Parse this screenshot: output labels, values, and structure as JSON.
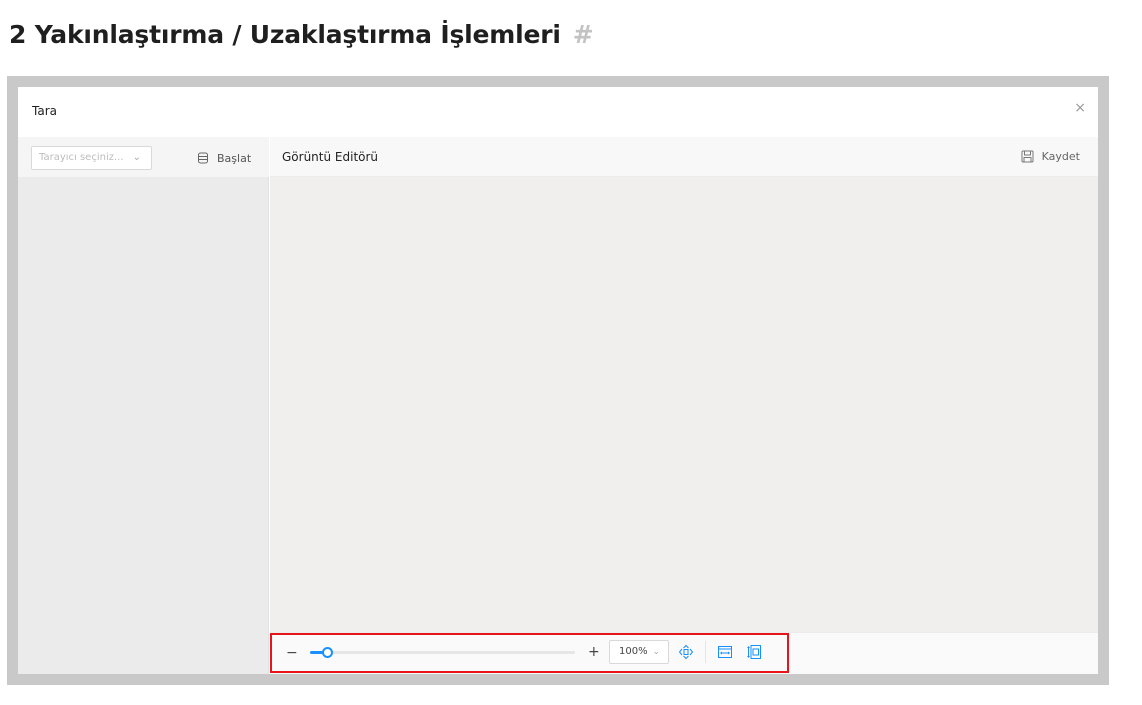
{
  "heading": {
    "text": "2 Yakınlaştırma / Uzaklaştırma İşlemleri",
    "anchor": "#"
  },
  "dialog": {
    "title": "Tara",
    "close_icon": "×",
    "scanner_select": {
      "placeholder": "Tarayıcı seçiniz...",
      "chevron": "⌄"
    },
    "start_label": "Başlat",
    "editor_title": "Görüntü Editörü",
    "save_label": "Kaydet"
  },
  "zoom_toolbar": {
    "zoom_out_label": "−",
    "zoom_in_label": "+",
    "slider_value": 0.05,
    "zoom_value": "100%",
    "zoom_chevron": "⌄",
    "icons": [
      "fit-center-icon",
      "fit-width-icon",
      "fit-height-icon"
    ]
  },
  "colors": {
    "accent": "#1890ff",
    "highlight": "#e8141b",
    "frame": "#c9c9c9"
  }
}
